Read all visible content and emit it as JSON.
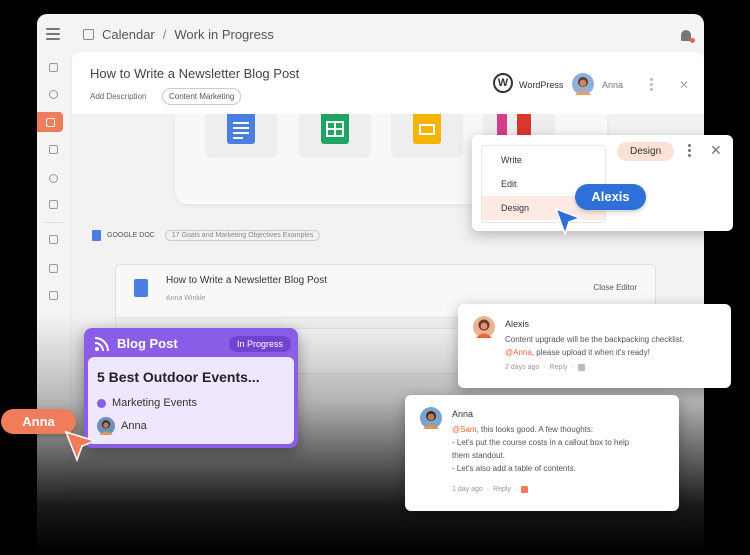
{
  "breadcrumb": {
    "root": "Calendar",
    "separator": "/",
    "current": "Work in Progress"
  },
  "doc": {
    "title": "How to Write a Newsletter Blog Post",
    "add_description": "Add Description",
    "tag": "Content Marketing",
    "integration": "WordPress",
    "wp_glyph": "W",
    "assignee": "Anna",
    "close_glyph": "✕"
  },
  "google_doc": {
    "label": "GOOGLE DOC",
    "pill": "17 Goals and Marketing Objectives Examples"
  },
  "editor": {
    "title": "How to Write a Newsletter Blog Post",
    "author": "Anna Winkle",
    "close": "Close Editor"
  },
  "menu": {
    "items": [
      {
        "label": "Write"
      },
      {
        "label": "Edit"
      },
      {
        "label": "Design",
        "selected": true
      }
    ],
    "selected_pill": "Design",
    "close_glyph": "✕"
  },
  "cursors": {
    "blue_label": "Alexis",
    "orange_label": "Anna"
  },
  "blog_card": {
    "type": "Blog Post",
    "status": "In Progress",
    "title": "5 Best Outdoor Events...",
    "category": "Marketing Events",
    "assignee": "Anna"
  },
  "comments": [
    {
      "name": "Alexis",
      "line1": "Content upgrade will be the backpacking checklist.",
      "mention": "@Anna",
      "line2_rest": ", please upload it when it's ready!",
      "meta_time": "2 days ago",
      "meta_dot": "·",
      "meta_reply": "Reply",
      "meta_dot2": "·"
    },
    {
      "name": "Anna",
      "mention": "@Sam",
      "line1_rest": ", this looks good. A few thoughts:",
      "line2": "- Let's put the course costs in a callout box to help",
      "line3": "them standout.",
      "line4": "- Let's also add a table of contents.",
      "meta_time": "1 day ago",
      "meta_dot": "·",
      "meta_reply": "Reply",
      "meta_dot2": "·"
    }
  ],
  "colors": {
    "accent_orange": "#ef7d5b",
    "accent_blue": "#2e6fd8",
    "blog_purple": "#8a5de6",
    "docs_blue": "#4a7fe0",
    "sheets_green": "#20a463",
    "slides_yellow": "#f4b400"
  }
}
